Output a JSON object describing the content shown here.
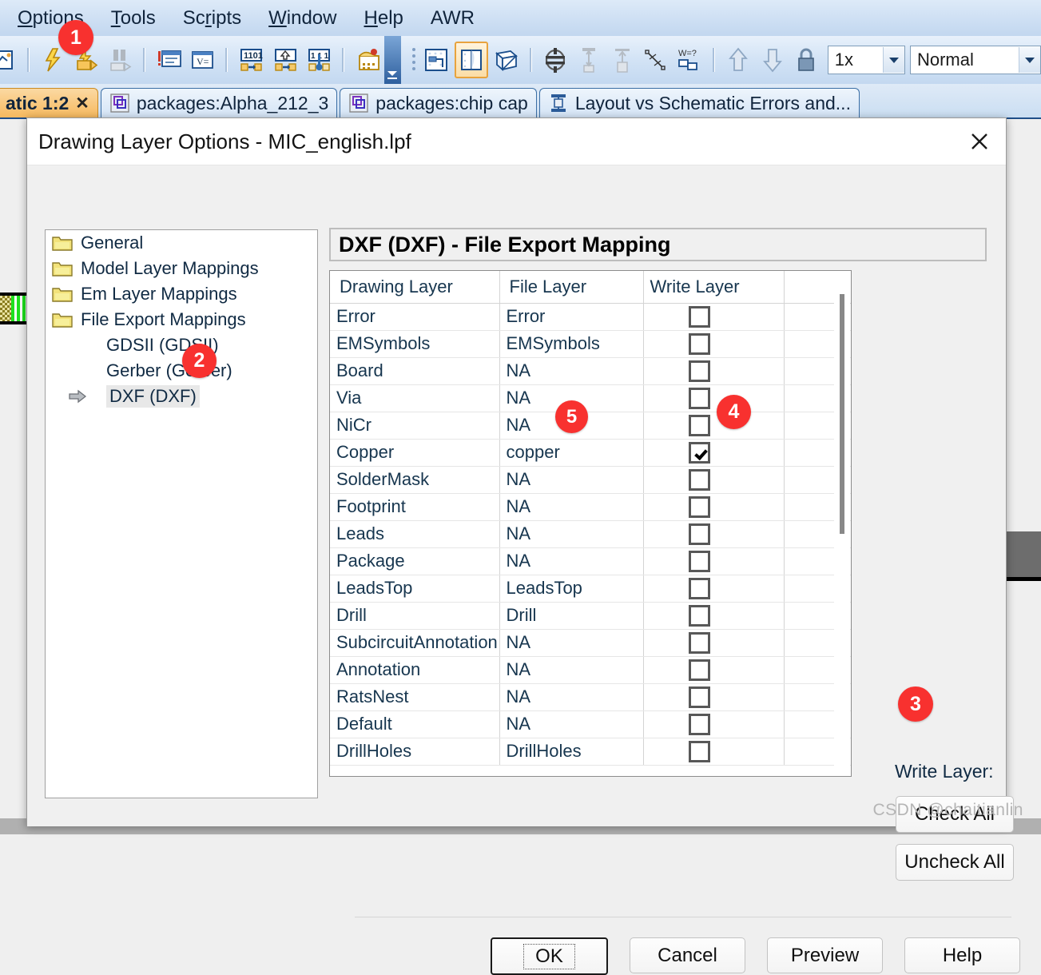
{
  "menubar": {
    "items": [
      {
        "label": "Options",
        "accel": "O"
      },
      {
        "label": "Tools",
        "accel": "T"
      },
      {
        "label": "Scripts",
        "accel": "r"
      },
      {
        "label": "Window",
        "accel": "W"
      },
      {
        "label": "Help",
        "accel": "H"
      },
      {
        "label": "AWR",
        "accel": ""
      }
    ]
  },
  "toolbar": {
    "icons": [
      "layout-icon",
      "lightning-icon",
      "simulate-icon",
      "pause-icon",
      "annotate-icon",
      "equation-icon",
      "data-1101-icon",
      "data-up-icon",
      "tune-icon",
      "output-icon"
    ],
    "icons2": [
      "snap-icon",
      "layer-icon",
      "3d-view-icon",
      "drill-icon",
      "align-v-icon",
      "align-top-icon",
      "measure-icon",
      "width-icon",
      "move-up-icon",
      "move-down-icon",
      "lock-icon"
    ],
    "zoom_value": "1x",
    "mode_value": "Normal"
  },
  "tabs": [
    {
      "label": "atic 1:2",
      "active": true,
      "closable": true,
      "icon": ""
    },
    {
      "label": "packages:Alpha_212_3",
      "active": false,
      "closable": false,
      "icon": "layout-tab-icon"
    },
    {
      "label": "packages:chip cap",
      "active": false,
      "closable": false,
      "icon": "layout-tab-icon"
    },
    {
      "label": "Layout vs Schematic Errors and...",
      "active": false,
      "closable": false,
      "icon": "lvs-tab-icon"
    }
  ],
  "dialog": {
    "title": "Drawing Layer Options - MIC_english.lpf",
    "close_icon": "close-icon",
    "tree": [
      {
        "label": "General",
        "level": 0,
        "icon": "folder-icon",
        "selected": false
      },
      {
        "label": "Model Layer Mappings",
        "level": 0,
        "icon": "folder-icon",
        "selected": false
      },
      {
        "label": "Em Layer Mappings",
        "level": 0,
        "icon": "folder-icon",
        "selected": false
      },
      {
        "label": "File Export Mappings",
        "level": 0,
        "icon": "folder-icon",
        "selected": false
      },
      {
        "label": "GDSII (GDSII)",
        "level": 1,
        "icon": "",
        "selected": false
      },
      {
        "label": "Gerber (Gerber)",
        "level": 1,
        "icon": "",
        "selected": false
      },
      {
        "label": "DXF (DXF)",
        "level": 1,
        "icon": "arrow-marker-icon",
        "selected": true
      }
    ],
    "panel_header": "DXF (DXF) - File Export Mapping",
    "grid": {
      "columns": [
        "Drawing Layer",
        "File Layer",
        "Write Layer",
        ""
      ],
      "rows": [
        {
          "drawing_layer": "Error",
          "file_layer": "Error",
          "write_layer": false
        },
        {
          "drawing_layer": "EMSymbols",
          "file_layer": "EMSymbols",
          "write_layer": false
        },
        {
          "drawing_layer": "Board",
          "file_layer": "NA",
          "write_layer": false
        },
        {
          "drawing_layer": "Via",
          "file_layer": "NA",
          "write_layer": false
        },
        {
          "drawing_layer": "NiCr",
          "file_layer": "NA",
          "write_layer": false
        },
        {
          "drawing_layer": "Copper",
          "file_layer": "copper",
          "write_layer": true
        },
        {
          "drawing_layer": "SolderMask",
          "file_layer": "NA",
          "write_layer": false
        },
        {
          "drawing_layer": "Footprint",
          "file_layer": "NA",
          "write_layer": false
        },
        {
          "drawing_layer": "Leads",
          "file_layer": "NA",
          "write_layer": false
        },
        {
          "drawing_layer": "Package",
          "file_layer": "NA",
          "write_layer": false
        },
        {
          "drawing_layer": "LeadsTop",
          "file_layer": "LeadsTop",
          "write_layer": false
        },
        {
          "drawing_layer": "Drill",
          "file_layer": "Drill",
          "write_layer": false
        },
        {
          "drawing_layer": "SubcircuitAnnotation",
          "file_layer": "NA",
          "write_layer": false
        },
        {
          "drawing_layer": "Annotation",
          "file_layer": "NA",
          "write_layer": false
        },
        {
          "drawing_layer": "RatsNest",
          "file_layer": "NA",
          "write_layer": false
        },
        {
          "drawing_layer": "Default",
          "file_layer": "NA",
          "write_layer": false
        },
        {
          "drawing_layer": "DrillHoles",
          "file_layer": "DrillHoles",
          "write_layer": false
        }
      ]
    },
    "side": {
      "write_layer_label": "Write Layer:",
      "check_all": "Check All",
      "uncheck_all": "Uncheck All"
    },
    "buttons": {
      "ok": "OK",
      "cancel": "Cancel",
      "preview": "Preview",
      "help": "Help"
    }
  },
  "badges": [
    {
      "n": "1"
    },
    {
      "n": "2"
    },
    {
      "n": "3"
    },
    {
      "n": "4"
    },
    {
      "n": "5"
    }
  ],
  "watermark": "CSDN @chaitianlin",
  "colors": {
    "badge": "#f8312f",
    "active_tab": "#f6b95f",
    "accent": "#1f4e88"
  }
}
